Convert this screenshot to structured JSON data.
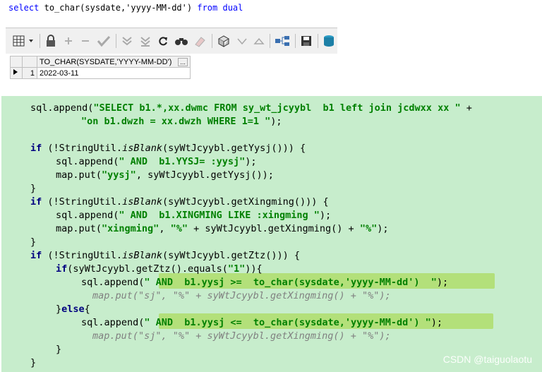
{
  "sql_editor": {
    "kw_select": "select",
    "fn_call": "to_char(sysdate,'yyyy-MM-dd')",
    "kw_from": "from",
    "table": "dual"
  },
  "toolbar": {
    "icons": [
      "grid-menu-icon",
      "lock-icon",
      "add-record-icon",
      "delete-record-icon",
      "post-icon",
      "filter-down-icon",
      "filter-clear-icon",
      "refresh-icon",
      "find-icon",
      "clear-icon",
      "query-builder-icon",
      "sort-down-icon",
      "sort-up-icon",
      "connect-icon",
      "save-icon",
      "export-icon"
    ]
  },
  "result_grid": {
    "column_header": "TO_CHAR(SYSDATE,'YYYY-MM-DD')",
    "header_button": "...",
    "rows": [
      {
        "num": "1",
        "value": "2022-03-11"
      }
    ]
  },
  "code": {
    "l1a": "sql.append(",
    "l1b": "\"SELECT b1.*,xx.dwmc FROM sy_wt_jcyybl  b1 left join jcdwxx xx \"",
    "l1c": " +",
    "l2": "\"on b1.dwzh = xx.dwzh WHERE 1=1 \"",
    "l2b": ");",
    "if": "if",
    "l4a": " (!StringUtil.",
    "isBlank": "isBlank",
    "l4b": "(syWtJcyybl.getYysj())) {",
    "l5a": "sql.append(",
    "l5b": "\" AND  b1.YYSJ= :yysj\"",
    "l5c": ");",
    "l6a": "map.put(",
    "l6b": "\"yysj\"",
    "l6c": ", syWtJcyybl.getYysj());",
    "close": "}",
    "l8b": "(syWtJcyybl.getXingming())) {",
    "l9b": "\" AND  b1.XINGMING LIKE :xingming \"",
    "l10b": "\"xingming\"",
    "l10c": ", ",
    "l10d": "\"%\"",
    "l10e": " + syWtJcyybl.getXingming() + ",
    "l10f": "\"%\"",
    "l10g": ");",
    "l12b": "(syWtJcyybl.getZtz())) {",
    "l13a": "if",
    "l13b": "(syWtJcyybl.getZtz().equals(",
    "l13c": "\"1\"",
    "l13d": ")){",
    "l14a": "sql.append(",
    "l14b": "\" AND  b1.yysj >=  to_char(sysdate,'yyyy-MM-dd')  \"",
    "l14c": ");",
    "l15": "map.put(\"sj\", \"%\" + syWtJcyybl.getXingming() + \"%\");",
    "l16a": "}",
    "l16b": "else",
    "l16c": "{",
    "l17b": "\" AND  b1.yysj <=  to_char(sysdate,'yyyy-MM-dd') \"",
    "l17c": ");",
    "l18": "map.put(\"sj\", \"%\" + syWtJcyybl.getXingming() + \"%\");"
  },
  "watermark": "CSDN @taiguolaotu",
  "colors": {
    "editor_bg": "#c7edcc",
    "highlight": "#b3e07a",
    "keyword": "#000080",
    "string": "#008000"
  }
}
